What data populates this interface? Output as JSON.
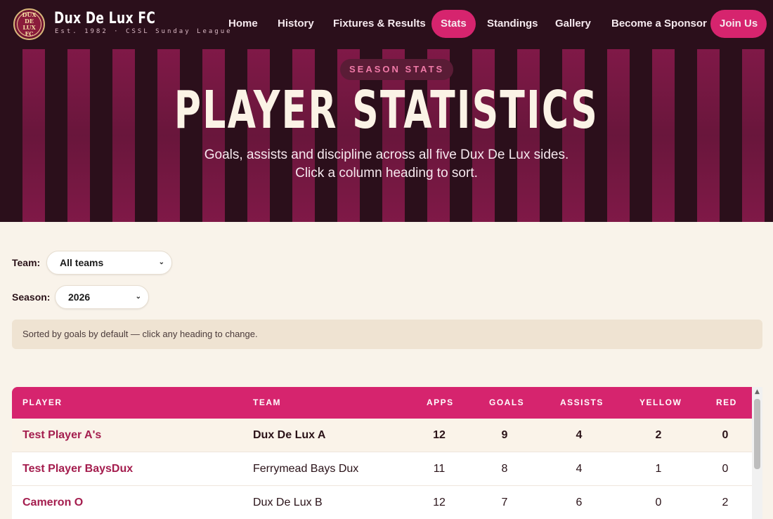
{
  "brand": {
    "name": "Dux De Lux FC",
    "tagline": "Est. 1982 · CSSL Sunday League",
    "logo_text": "Dux De Lux FC"
  },
  "nav": {
    "items": [
      {
        "label": "Home"
      },
      {
        "label": "History"
      },
      {
        "label": "Fixtures & Results"
      },
      {
        "label": "Stats",
        "active": true
      },
      {
        "label": "Standings"
      },
      {
        "label": "Gallery"
      },
      {
        "label": "Become a Sponsor"
      }
    ],
    "cta": "Join Us"
  },
  "hero": {
    "badge": "SEASON STATS",
    "title": "PLAYER STATISTICS",
    "subtitle_line1": "Goals, assists and discipline across all five Dux De Lux sides.",
    "subtitle_line2": "Click a column heading to sort."
  },
  "filters": {
    "team_label": "Team:",
    "team_value": "All teams",
    "season_label": "Season:",
    "season_value": "2026"
  },
  "note": "Sorted by goals by default — click any heading to change.",
  "table": {
    "headers": {
      "player": "PLAYER",
      "team": "TEAM",
      "apps": "APPS",
      "goals": "GOALS",
      "assists": "ASSISTS",
      "yellow": "YELLOW",
      "red": "RED"
    },
    "rows": [
      {
        "player": "Test Player A's",
        "team": "Dux De Lux A",
        "apps": "12",
        "goals": "9",
        "assists": "4",
        "yellow": "2",
        "red": "0"
      },
      {
        "player": "Test Player BaysDux",
        "team": "Ferrymead Bays Dux",
        "apps": "11",
        "goals": "8",
        "assists": "4",
        "yellow": "1",
        "red": "0"
      },
      {
        "player": "Cameron O",
        "team": "Dux De Lux B",
        "apps": "12",
        "goals": "7",
        "assists": "6",
        "yellow": "0",
        "red": "2"
      }
    ]
  },
  "colors": {
    "nav_bg": "#2b0f1b",
    "accent": "#d6246e",
    "page_bg": "#f9f3ea",
    "player_link": "#a41d4e"
  }
}
